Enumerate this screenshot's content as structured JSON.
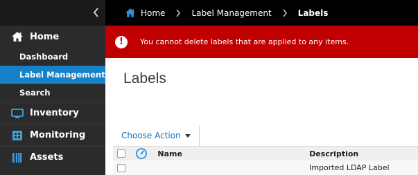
{
  "sidebar": {
    "home_label": "Home",
    "sub_items": [
      {
        "label": "Dashboard"
      },
      {
        "label": "Label Management"
      },
      {
        "label": "Search"
      }
    ],
    "sections": [
      {
        "label": "Inventory",
        "icon": "monitor-icon"
      },
      {
        "label": "Monitoring",
        "icon": "grid-icon"
      },
      {
        "label": "Assets",
        "icon": "barcode-icon"
      }
    ],
    "active_color": "#1581c8"
  },
  "breadcrumb": {
    "items": [
      "Home",
      "Label Management",
      "Labels"
    ]
  },
  "alert": {
    "message": "You cannot delete labels that are applied to any items.",
    "color": "#c00000"
  },
  "main": {
    "title": "Labels",
    "choose_action": "Choose Action",
    "table": {
      "columns": [
        "Name",
        "Description"
      ],
      "rows": [
        {
          "name": "",
          "description": "Imported LDAP Label"
        }
      ]
    }
  }
}
